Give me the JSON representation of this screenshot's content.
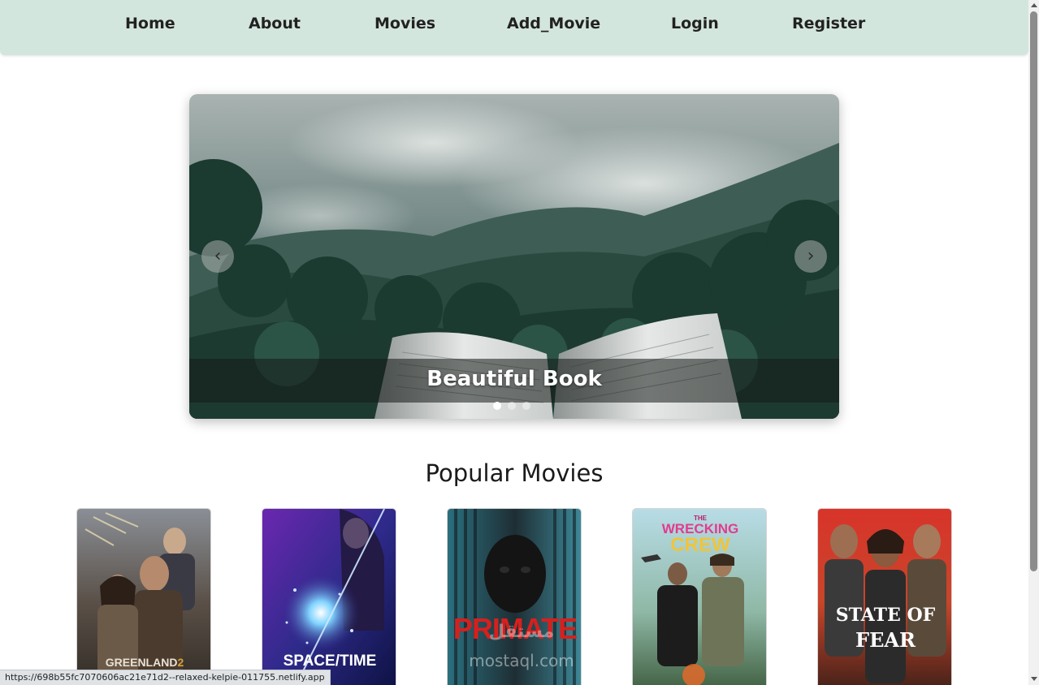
{
  "nav": {
    "items": [
      {
        "label": "Home"
      },
      {
        "label": "About"
      },
      {
        "label": "Movies"
      },
      {
        "label": "Add_Movie"
      },
      {
        "label": "Login"
      },
      {
        "label": "Register"
      }
    ],
    "background": "#d3e6dd"
  },
  "carousel": {
    "caption": "Beautiful Book",
    "prev_glyph": "‹",
    "next_glyph": "›",
    "slide_count": 3,
    "active_slide": 1
  },
  "popular": {
    "title": "Popular Movies",
    "movies": [
      {
        "title": "GREENLAND 2"
      },
      {
        "title": "SPACE/TIME"
      },
      {
        "title": "PRIMATE"
      },
      {
        "title": "THE WRECKING CREW"
      },
      {
        "title": "STATE OF FEAR"
      }
    ]
  },
  "watermark": {
    "arabic": "مستقل",
    "latin": "mostaql.com"
  },
  "status_bar": {
    "url": "https://698b55fc7070606ac21e71d2--relaxed-kelpie-011755.netlify.app"
  },
  "icons": {
    "prev": "chevron-left-icon",
    "next": "chevron-right-icon"
  }
}
